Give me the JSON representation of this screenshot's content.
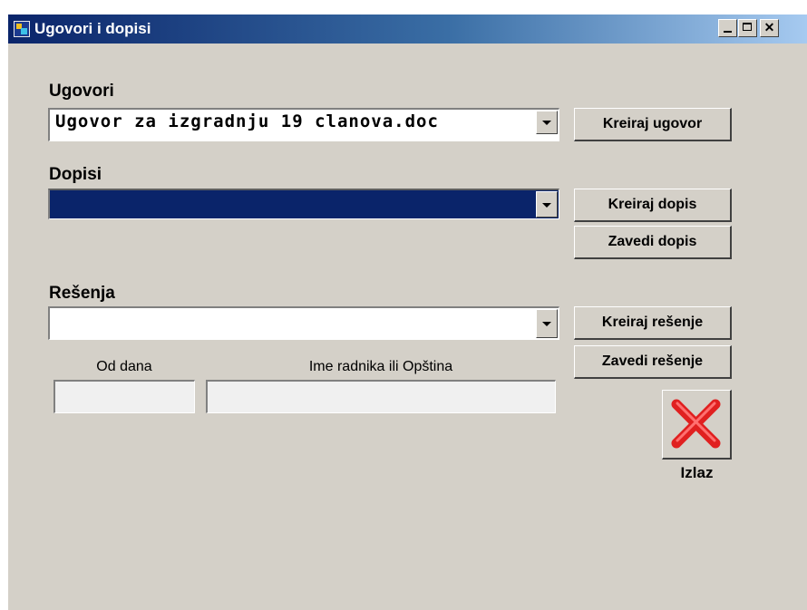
{
  "window": {
    "title": "Ugovori i dopisi",
    "title_bar_color": "#0a246a"
  },
  "ugovori": {
    "label": "Ugovori",
    "selected": "Ugovor za izgradnju 19 clanova.doc",
    "create_button": "Kreiraj ugovor"
  },
  "dopisi": {
    "label": "Dopisi",
    "selected": "",
    "selection_color": "#0a246a",
    "create_button": "Kreiraj dopis",
    "register_button": "Zavedi dopis"
  },
  "resenja": {
    "label": "Rešenja",
    "selected": "",
    "create_button": "Kreiraj rešenje",
    "register_button": "Zavedi rešenje",
    "od_dana_label": "Od dana",
    "od_dana_value": "",
    "ime_label": "Ime radnika ili Opština",
    "ime_value": ""
  },
  "exit": {
    "label": "Izlaz",
    "icon": "red-x-icon",
    "icon_color": "#e02020"
  }
}
